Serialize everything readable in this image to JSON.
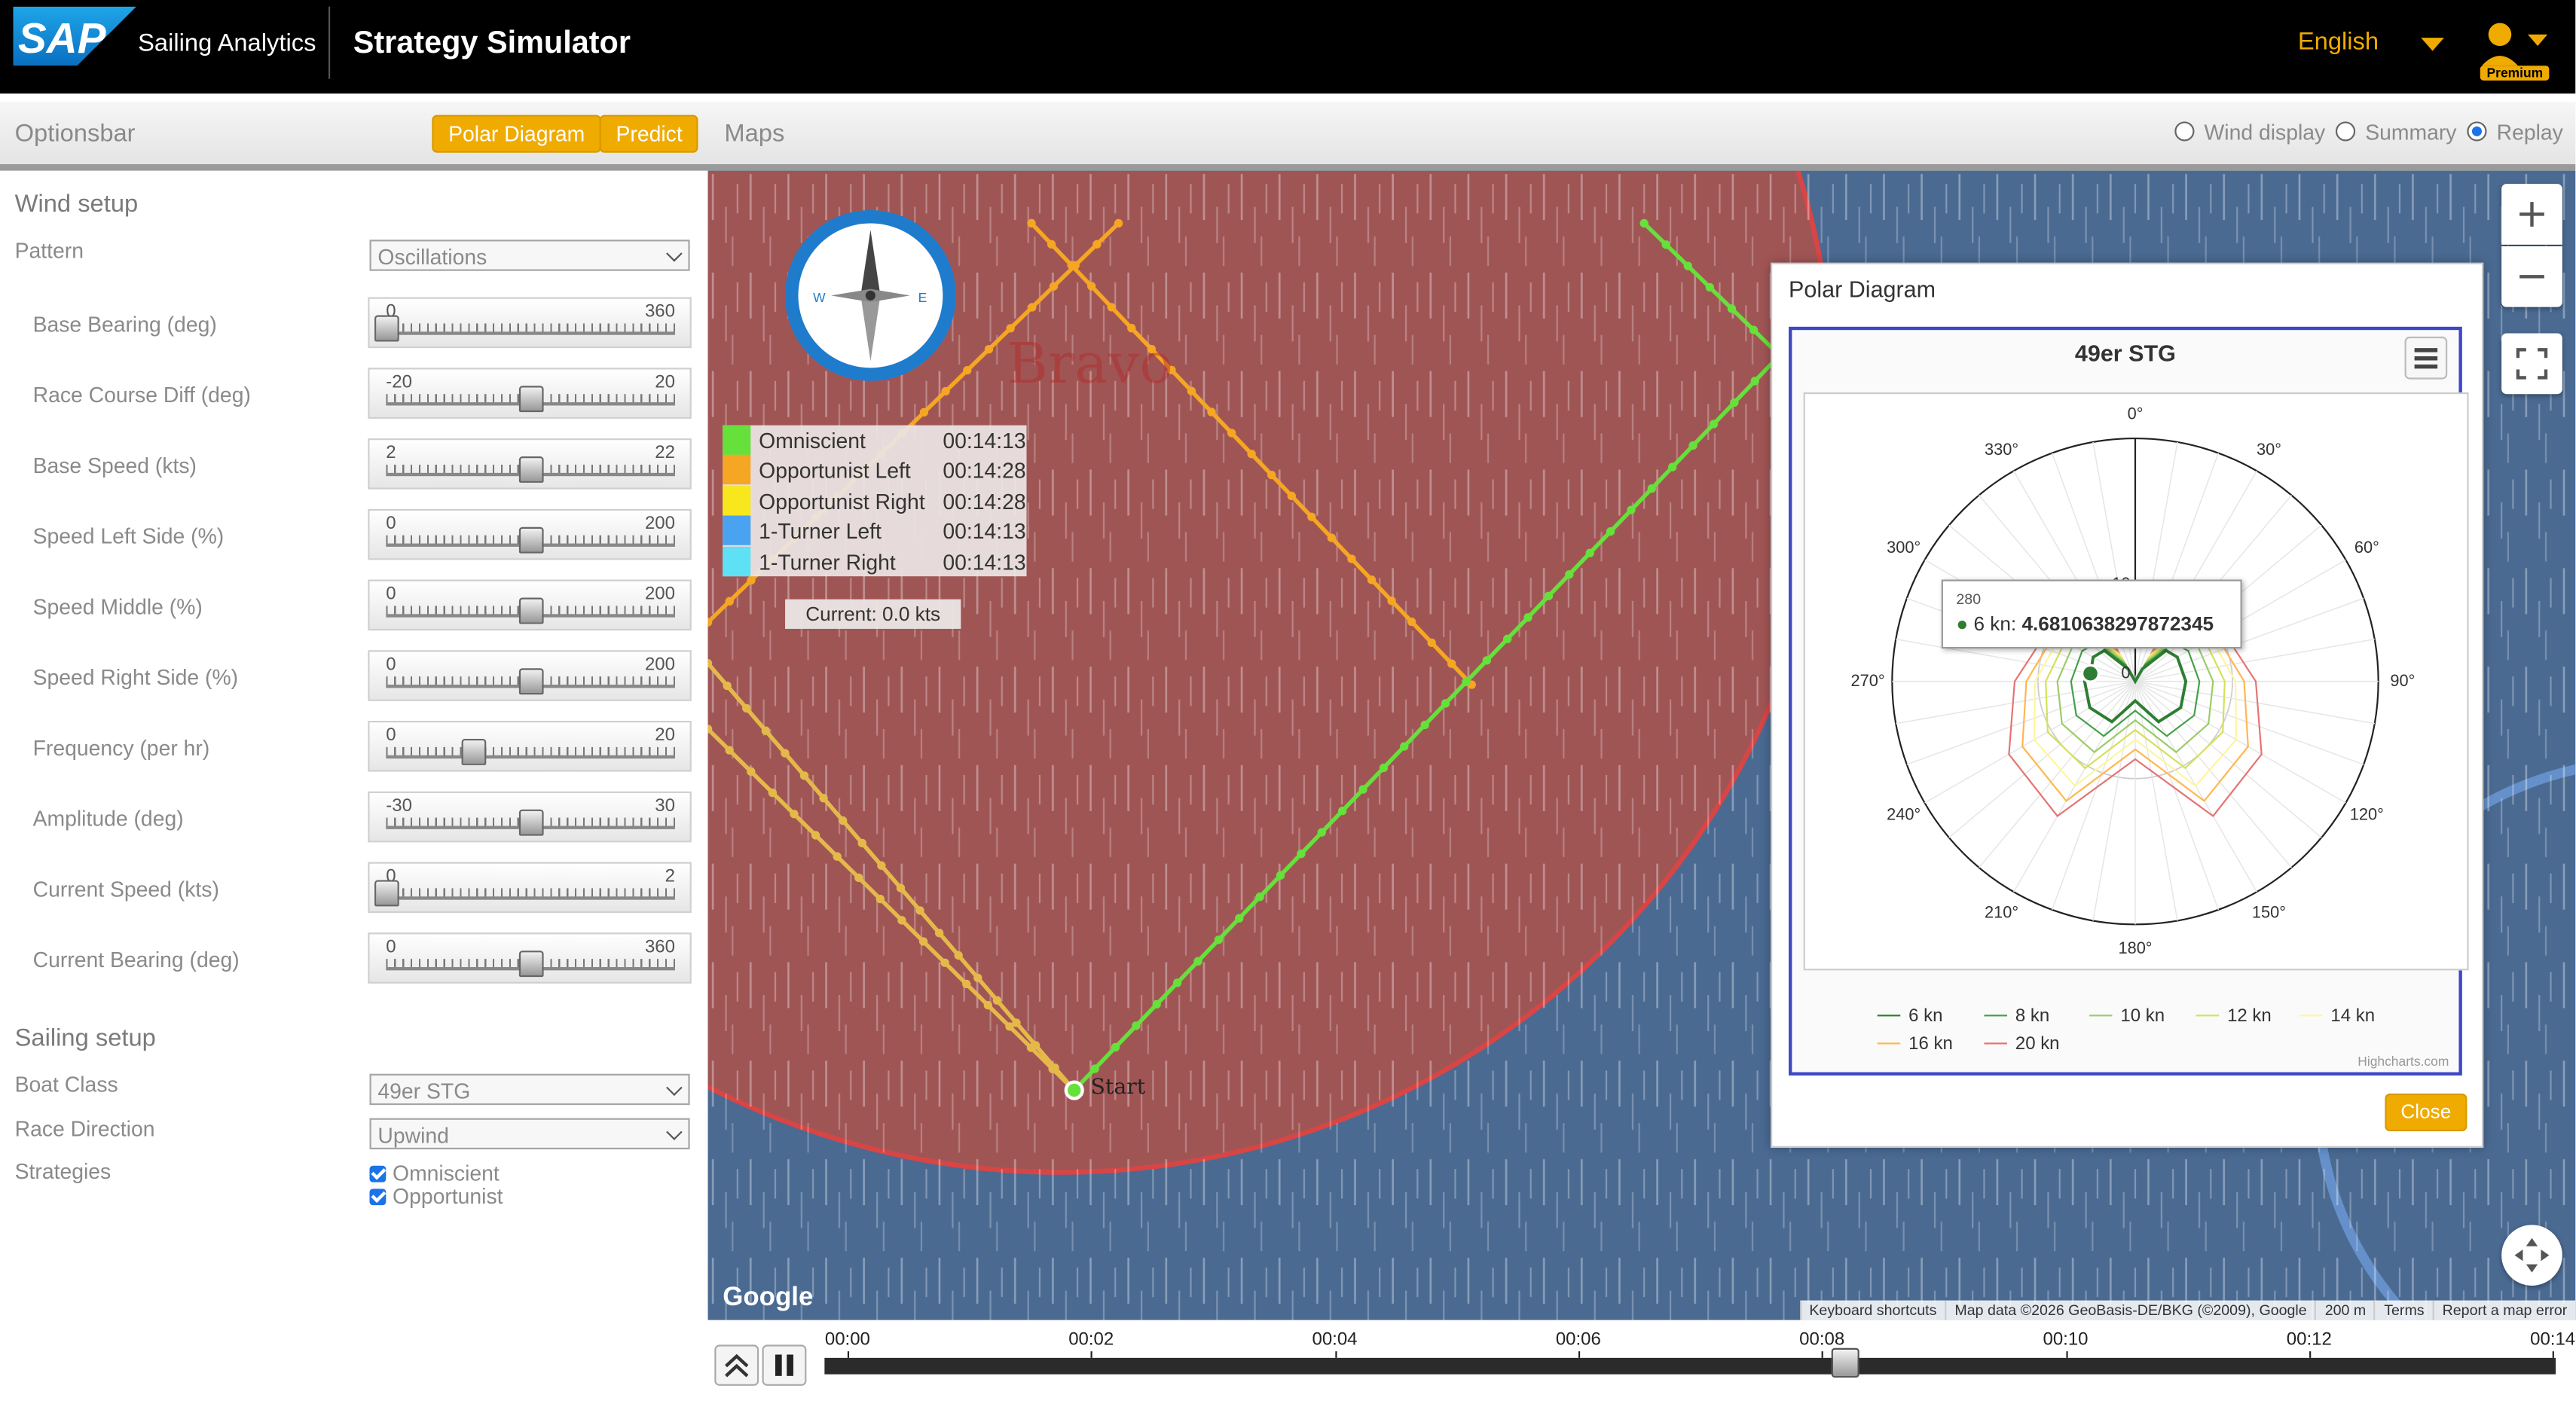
{
  "header": {
    "logo_text": "SAP",
    "app_name": "Sailing Analytics",
    "page_title": "Strategy Simulator",
    "language": "English",
    "badge": "Premium"
  },
  "optionsbar": {
    "title": "Optionsbar",
    "buttons": [
      "Polar Diagram",
      "Predict"
    ],
    "maps_label": "Maps",
    "radios": [
      {
        "label": "Wind display",
        "checked": false
      },
      {
        "label": "Summary",
        "checked": false
      },
      {
        "label": "Replay",
        "checked": true
      }
    ]
  },
  "wind_setup": {
    "title": "Wind setup",
    "pattern_label": "Pattern",
    "pattern_value": "Oscillations",
    "sliders": [
      {
        "label": "Base Bearing (deg)",
        "min": "0",
        "max": "360",
        "value_fraction": 0.0
      },
      {
        "label": "Race Course Diff (deg)",
        "min": "-20",
        "max": "20",
        "value_fraction": 0.5
      },
      {
        "label": "Base Speed (kts)",
        "min": "2",
        "max": "22",
        "value_fraction": 0.5
      },
      {
        "label": "Speed Left Side (%)",
        "min": "0",
        "max": "200",
        "value_fraction": 0.5
      },
      {
        "label": "Speed Middle (%)",
        "min": "0",
        "max": "200",
        "value_fraction": 0.5
      },
      {
        "label": "Speed Right Side (%)",
        "min": "0",
        "max": "200",
        "value_fraction": 0.5
      },
      {
        "label": "Frequency (per hr)",
        "min": "0",
        "max": "20",
        "value_fraction": 0.3
      },
      {
        "label": "Amplitude (deg)",
        "min": "-30",
        "max": "30",
        "value_fraction": 0.5
      },
      {
        "label": "Current Speed (kts)",
        "min": "0",
        "max": "2",
        "value_fraction": 0.0
      },
      {
        "label": "Current Bearing (deg)",
        "min": "0",
        "max": "360",
        "value_fraction": 0.5
      }
    ]
  },
  "sailing_setup": {
    "title": "Sailing setup",
    "boat_class_label": "Boat Class",
    "boat_class_value": "49er STG",
    "race_direction_label": "Race Direction",
    "race_direction_value": "Upwind",
    "strategies_label": "Strategies",
    "strategies": [
      {
        "label": "Omniscient",
        "checked": true
      },
      {
        "label": "Opportunist",
        "checked": true
      }
    ]
  },
  "map": {
    "compass_w": "W",
    "compass_e": "E",
    "area_label": "Bravo",
    "start_label": "Start",
    "current_label": "Current: 0.0 kts",
    "legend": [
      {
        "name": "Omniscient",
        "time": "00:14:13",
        "color": "#66e03a"
      },
      {
        "name": "Opportunist Left",
        "time": "00:14:28",
        "color": "#f5a623"
      },
      {
        "name": "Opportunist Right",
        "time": "00:14:28",
        "color": "#f8e71c"
      },
      {
        "name": "1-Turner Left",
        "time": "00:14:13",
        "color": "#4aa3f0"
      },
      {
        "name": "1-Turner Right",
        "time": "00:14:13",
        "color": "#5ee0f5"
      }
    ],
    "google": "Google",
    "attribution": [
      "Keyboard shortcuts",
      "Map data ©2026 GeoBasis-DE/BKG (©2009), Google",
      "200 m",
      "Terms",
      "Report a map error"
    ]
  },
  "polar_dialog": {
    "title": "Polar Diagram",
    "close_label": "Close",
    "chart_menu_icon": "hamburger-icon",
    "credits": "Highcharts.com",
    "tooltip": {
      "category": "280",
      "series": "6 kn",
      "value": "4.6810638297872345"
    }
  },
  "chart_data": {
    "type": "polar-line",
    "title": "49er STG",
    "angle_ticks": [
      "0°",
      "30°",
      "60°",
      "90°",
      "120°",
      "150°",
      "180°",
      "210°",
      "240°",
      "270°",
      "300°",
      "330°"
    ],
    "radial_ticks": [
      "0",
      "10"
    ],
    "series": [
      {
        "name": "6 kn",
        "color": "#2e7d32",
        "angles": [
          0,
          30,
          45,
          60,
          90,
          120,
          150,
          180,
          210,
          240,
          270,
          280,
          300,
          315,
          330
        ],
        "values": [
          0,
          1.5,
          4.5,
          5.0,
          5.2,
          5.4,
          4.8,
          2.0,
          4.8,
          5.4,
          5.2,
          4.68,
          5.0,
          4.5,
          1.5
        ]
      },
      {
        "name": "8 kn",
        "color": "#43a047",
        "angles": [
          0,
          30,
          45,
          60,
          90,
          120,
          150,
          180,
          210,
          240,
          270,
          300,
          315,
          330
        ],
        "values": [
          0,
          2.0,
          5.6,
          6.3,
          6.6,
          7.0,
          6.5,
          3.0,
          6.5,
          7.0,
          6.6,
          6.3,
          5.6,
          2.0
        ]
      },
      {
        "name": "10 kn",
        "color": "#9ccc65",
        "angles": [
          0,
          30,
          45,
          60,
          90,
          120,
          150,
          180,
          210,
          240,
          270,
          300,
          315,
          330
        ],
        "values": [
          0,
          2.4,
          6.6,
          7.4,
          8.0,
          8.7,
          8.4,
          4.0,
          8.4,
          8.7,
          8.0,
          7.4,
          6.6,
          2.4
        ]
      },
      {
        "name": "12 kn",
        "color": "#d4e157",
        "angles": [
          0,
          30,
          45,
          60,
          90,
          120,
          150,
          180,
          210,
          240,
          270,
          300,
          315,
          330
        ],
        "values": [
          0,
          2.8,
          7.3,
          8.3,
          9.2,
          10.4,
          10.3,
          5.0,
          10.3,
          10.4,
          9.2,
          8.3,
          7.3,
          2.8
        ]
      },
      {
        "name": "14 kn",
        "color": "#fff59d",
        "angles": [
          0,
          30,
          45,
          60,
          90,
          120,
          150,
          180,
          210,
          240,
          270,
          300,
          315,
          330
        ],
        "values": [
          0,
          3.1,
          7.9,
          9.0,
          10.3,
          12.0,
          12.4,
          6.0,
          12.4,
          12.0,
          10.3,
          9.0,
          7.9,
          3.1
        ]
      },
      {
        "name": "16 kn",
        "color": "#ffb74d",
        "angles": [
          0,
          30,
          45,
          60,
          90,
          120,
          150,
          180,
          210,
          240,
          270,
          300,
          315,
          330
        ],
        "values": [
          0,
          3.4,
          8.4,
          9.6,
          11.2,
          13.4,
          14.2,
          7.0,
          14.2,
          13.4,
          11.2,
          9.6,
          8.4,
          3.4
        ]
      },
      {
        "name": "20 kn",
        "color": "#e57373",
        "angles": [
          0,
          30,
          45,
          60,
          90,
          120,
          150,
          180,
          210,
          240,
          270,
          300,
          315,
          330
        ],
        "values": [
          0,
          3.8,
          9.0,
          10.4,
          12.4,
          15.0,
          16.0,
          8.0,
          16.0,
          15.0,
          12.4,
          10.4,
          9.0,
          3.8
        ]
      }
    ],
    "radial_max": 25,
    "legend_placement": "bottom",
    "tooltip_point": {
      "angle": 280,
      "value": 4.6810638297872345
    }
  },
  "timeline": {
    "labels": [
      "00:00",
      "00:02",
      "00:04",
      "00:06",
      "00:08",
      "00:10",
      "00:12",
      "00:14"
    ],
    "position_fraction": 0.589
  }
}
